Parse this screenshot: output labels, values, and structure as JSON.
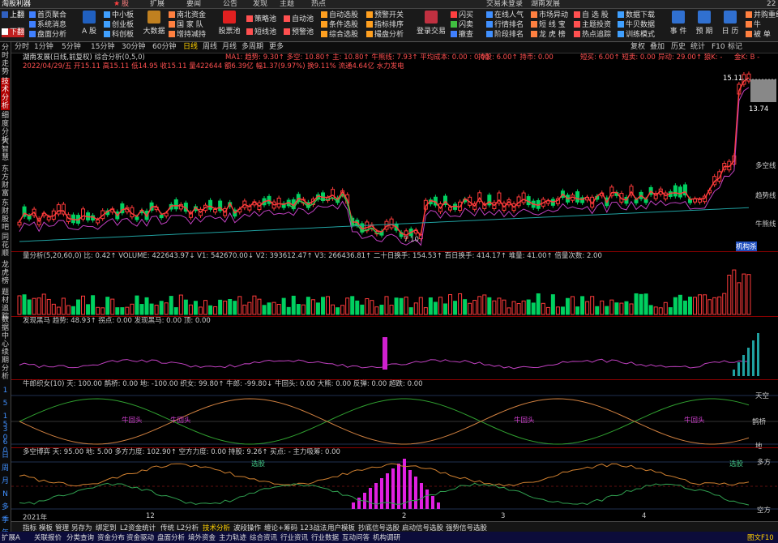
{
  "titlebar": {
    "app_name": "淘股利器",
    "menu": [
      "股",
      "扩展",
      "要闻",
      "公告",
      "发现",
      "主题",
      "热点"
    ],
    "login": "交易未登录",
    "stock_title": "湖南发展",
    "corner": "22"
  },
  "toolbar": {
    "nav_up": "上翻",
    "nav_down": "下翻",
    "col1": [
      "首页聚合",
      "系统消息",
      "盘面分析"
    ],
    "stock_btn": "A 股",
    "col2": [
      "中小板",
      "创业板",
      "科创板"
    ],
    "big_data": "大数据",
    "col3": [
      "南北资金",
      "国 家 队",
      "增持减持"
    ],
    "stock_pool": "股票池",
    "col4": [
      "策略池",
      "短线池"
    ],
    "col5": [
      "自动池",
      "预警池"
    ],
    "col6": [
      "自动选股",
      "条件选股",
      "综合选股"
    ],
    "col7": [
      "预警开关",
      "指标排序",
      "撮盘分析"
    ],
    "trade": "登录交易",
    "col8": [
      "闪买",
      "闪卖",
      "撤查"
    ],
    "col9": [
      "在线人气",
      "行情排名",
      "阶段排名"
    ],
    "col10": [
      "市场异动",
      "短 线 宝",
      "龙 虎 榜"
    ],
    "col11": [
      "自 选 股",
      "主题投资",
      "热点追踪"
    ],
    "col12": [
      "数据下载",
      "牛贝数据",
      "训练模式"
    ],
    "right_btns": [
      "事 件",
      "预 期",
      "日 历"
    ],
    "far_right": [
      "并购重组",
      "牛",
      "被 单"
    ]
  },
  "left_tabs": [
    "分时走势",
    "技术分析",
    "细度分析",
    "大智慧",
    "东方财富",
    "东财股吧",
    "同花顺",
    "龙虎榜",
    "题材追踪",
    "数据中心",
    "续期分析"
  ],
  "left_numbers": [
    "1",
    "5",
    "15",
    "30",
    "60",
    "日",
    "周",
    "月",
    "N",
    "多",
    "季",
    "年"
  ],
  "period_bar": {
    "items": [
      "分时",
      "1分钟",
      "5分钟",
      "15分钟",
      "30分钟",
      "60分钟",
      "日线",
      "周线",
      "月线",
      "多周期",
      "更多"
    ],
    "active_index": 6,
    "right_items": [
      "复权",
      "叠加",
      "历史",
      "统计",
      "F10",
      "标记"
    ]
  },
  "main_chart": {
    "title": "湖南发展(日线,前复权)",
    "indicator": "综合分析(0,5,0)",
    "ma_label": "MA1: 趋势: 9.30↑ 多空: 10.80↑ 主: 10.80↑ 牛熊线: 7.93↑ 平均成本: 0.00 : 0.00",
    "ma_right": "持股: 6.00↑ 持币: 0.00",
    "ma_right2": "短买: 6.00↑ 短卖: 0.00",
    "ma_right3": "异动: 29.00↑ 狼K: -",
    "ma_right4": "金K: B -",
    "quote": "2022/04/29/五 开15.11 高15.11 低14.95 收15.11 量422644 额6.39亿 幅1.37(9.97%) 换9.11% 流通4.64亿 水力发电",
    "high_price": "15.11",
    "latest_price": "13.74",
    "low_price": "7.10",
    "line_labels": [
      "多空线",
      "趋势线",
      "牛熊线"
    ],
    "kdj_label": "机构杀"
  },
  "volume_panel": {
    "label": "量分析(5,20,60,0) 比: 0.42↑ VOLUME: 422643.97↓ V1: 542670.00↓ V2: 393612.47↑ V3: 266436.81↑ 二十日换手: 154.53↑ 百日换手: 414.17↑ 堆量: 41.00↑ 倍量次数: 2.00"
  },
  "panel3": {
    "label": "发现黑马 趋势: 48.93↑ 拐点: 0.00 发现黑马: 0.00 顶: 0.00"
  },
  "panel4": {
    "label": "牛郎织女(10) 天: 100.00 鹊桥: 0.00 地: -100.00 织女: 99.80↑ 牛郎: -99.80↓ 牛回头: 0.00 大熊: 0.00 反弹: 0.00 超跌: 0.00",
    "right_labels": [
      "天空",
      "鹊桥",
      "地"
    ],
    "tag": "牛回头"
  },
  "panel5": {
    "label": "多空博弈 天: 95.00 地: 5.00 多方力度: 102.90↑ 空方力度: 0.00 持股: 9.26↑ 买点: - 主力吸筹: 0.00",
    "right_labels": [
      "多方",
      "空方"
    ],
    "tag": "选股"
  },
  "xaxis": [
    "2021年",
    "12",
    "2",
    "3",
    "4"
  ],
  "bottom_tabs": [
    "指标",
    "模板",
    "管理",
    "另存为",
    "绑定到",
    "L2资金统计",
    "传统",
    "L2分析",
    "技术分析",
    "波段操作",
    "缠论+筹码",
    "123战法",
    "用户模板",
    "抄底信号选股",
    "启动信号选股",
    "强势信号选股"
  ],
  "statusbar": {
    "items": [
      "扩展A",
      "关联报价",
      "分类查询",
      "资金分布",
      "资金驱动",
      "盘面分析",
      "境外资金",
      "主力轨迹",
      "综合资讯",
      "行业资讯",
      "行业数据",
      "互动问答",
      "机构调研"
    ],
    "right": "图文F10"
  },
  "colors": {
    "up": "#ff3b3b",
    "down": "#00c0c0",
    "ma1": "#ff3b3b",
    "ma2": "#d040d0",
    "ma3": "#20a0a0",
    "accent": "#ffd000"
  },
  "chart_data": {
    "type": "line",
    "title": "湖南发展(日线,前复权)",
    "last": {
      "open": 15.11,
      "high": 15.11,
      "low": 14.95,
      "close": 15.11,
      "volume": 422644
    },
    "labels": [
      "15.11",
      "13.74",
      "7.10"
    ]
  }
}
